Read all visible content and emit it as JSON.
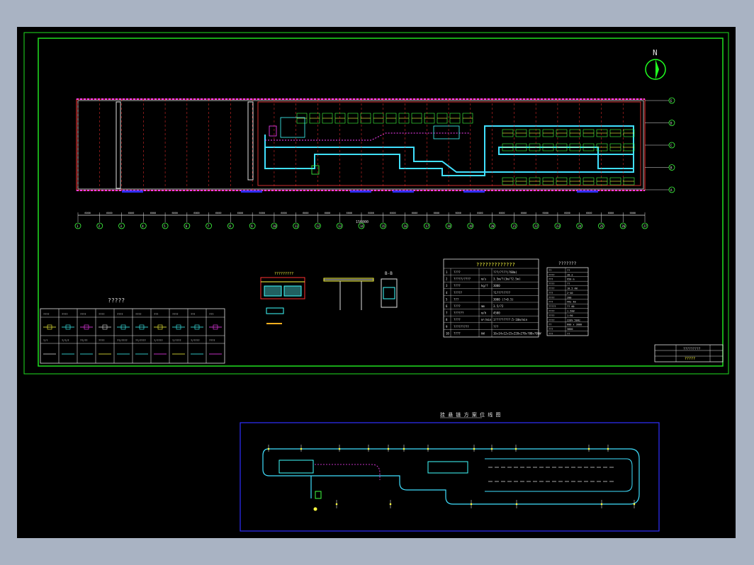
{
  "north_label": "N",
  "legend_title": "?????",
  "legend_row1": [
    "????",
    "????",
    "????",
    "????",
    "????",
    "????",
    "???",
    "????",
    "???",
    "???"
  ],
  "legend_row2": [
    "?/?",
    "?/?/?",
    "??/??",
    "????",
    "??/????",
    "??/????",
    "?/????",
    "?/????",
    "?/????",
    "????"
  ],
  "params_title": "?????????????",
  "params_rows": [
    {
      "n": "1",
      "name": "????",
      "unit": "",
      "value": "???/????(?88m)"
    },
    {
      "n": "2",
      "name": "?????/????",
      "unit": "m/s",
      "value": "3.5m/?(3m/?2.5m)"
    },
    {
      "n": "3",
      "name": "????",
      "unit": "kg/?",
      "value": "3000"
    },
    {
      "n": "4",
      "name": "?????",
      "unit": "",
      "value": "?1????????"
    },
    {
      "n": "5",
      "name": "???",
      "unit": "",
      "value": "3000 (?=0.5)"
    },
    {
      "n": "6",
      "name": "????",
      "unit": "mm",
      "value": "3.5/?2"
    },
    {
      "n": "7",
      "name": "??????",
      "unit": "m/h",
      "value": "4500"
    },
    {
      "n": "8",
      "name": "????",
      "unit": "m³/min",
      "value": "1?????????:5-10m/min"
    },
    {
      "n": "9",
      "name": "?????????",
      "unit": "",
      "value": "???"
    },
    {
      "n": "10",
      "name": "????",
      "unit": "kW",
      "value": "16+14+12+15+220+278+?00+?0kW"
    }
  ],
  "equip_title": "???????",
  "equip_rows": [
    [
      "??",
      "??"
    ],
    [
      "????",
      "28.2"
    ],
    [
      "???",
      "950 m"
    ],
    [
      "????",
      "??"
    ],
    [
      "????",
      "10.5 kW"
    ],
    [
      "???",
      "2~40"
    ],
    [
      "????",
      "200"
    ],
    [
      "???",
      "FRS 48"
    ],
    [
      "?????",
      "?? 60"
    ],
    [
      "????",
      "1.5kW"
    ],
    [
      "????",
      "1:90"
    ],
    [
      "????",
      "220V 50Hz"
    ],
    [
      "??",
      "600 x 3000"
    ],
    [
      "???",
      "3000"
    ],
    [
      "???",
      "??"
    ]
  ],
  "title_block_name": "?????",
  "title_block_note": "?????????",
  "section_a_label": "?????????",
  "section_b_label": "B-B",
  "route_title": "挂 悬 链 方 案 位 线 图",
  "grid_rows": [
    "E",
    "D",
    "C",
    "B",
    "A"
  ],
  "grid_cols": [
    "1",
    "2",
    "3",
    "4",
    "5",
    "6",
    "7",
    "8",
    "9",
    "10",
    "11",
    "12",
    "13",
    "14",
    "15",
    "16",
    "17",
    "18",
    "19",
    "20",
    "21",
    "22",
    "23",
    "24",
    "25",
    "26",
    "27"
  ],
  "dims": [
    "6000",
    "6000",
    "6000",
    "6000",
    "6000",
    "6000",
    "6000",
    "6000",
    "6000",
    "6000",
    "6000",
    "6000",
    "6000",
    "6000",
    "6000",
    "6000",
    "6000",
    "6000",
    "6000",
    "6000",
    "6000",
    "6000",
    "6000",
    "6000",
    "6000",
    "6000"
  ],
  "dim_total": "156000"
}
